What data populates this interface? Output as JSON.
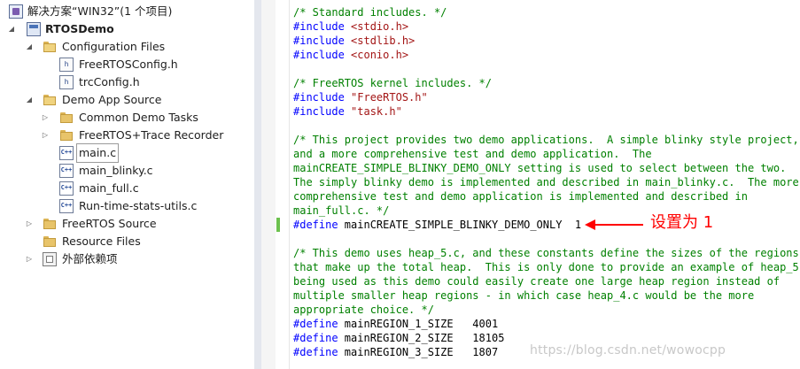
{
  "solution_explorer": {
    "solution_label": "解决方案“WIN32”(1 个项目)",
    "project": "RTOSDemo",
    "items": [
      {
        "label": "Configuration Files"
      },
      {
        "label": "FreeRTOSConfig.h"
      },
      {
        "label": "trcConfig.h"
      },
      {
        "label": "Demo App Source"
      },
      {
        "label": "Common Demo Tasks"
      },
      {
        "label": "FreeRTOS+Trace Recorder"
      },
      {
        "label": "main.c"
      },
      {
        "label": "main_blinky.c"
      },
      {
        "label": "main_full.c"
      },
      {
        "label": "Run-time-stats-utils.c"
      },
      {
        "label": "FreeRTOS Source"
      },
      {
        "label": "Resource Files"
      },
      {
        "label": "外部依赖项"
      }
    ],
    "icons": {
      "header_file": "h",
      "cpp_file": "C++"
    }
  },
  "code": {
    "l1": "/* Standard includes. */",
    "l2_kw": "#include",
    "l2_str": "<stdio.h>",
    "l3_kw": "#include",
    "l3_str": "<stdlib.h>",
    "l4_kw": "#include",
    "l4_str": "<conio.h>",
    "l6": "/* FreeRTOS kernel includes. */",
    "l7_kw": "#include",
    "l7_str": "\"FreeRTOS.h\"",
    "l8_kw": "#include",
    "l8_str": "\"task.h\"",
    "l10": "/* This project provides two demo applications.  A simple blinky style project,",
    "l11": "and a more comprehensive test and demo application.  The",
    "l12": "mainCREATE_SIMPLE_BLINKY_DEMO_ONLY setting is used to select between the two.",
    "l13": "The simply blinky demo is implemented and described in main_blinky.c.  The more",
    "l14": "comprehensive test and demo application is implemented and described in",
    "l15": "main_full.c. */",
    "l16_kw": "#define",
    "l16_rest": " mainCREATE_SIMPLE_BLINKY_DEMO_ONLY  1",
    "l18": "/* This demo uses heap_5.c, and these constants define the sizes of the regions",
    "l19": "that make up the total heap.  This is only done to provide an example of heap_5",
    "l20": "being used as this demo could easily create one large heap region instead of",
    "l21": "multiple smaller heap regions - in which case heap_4.c would be the more",
    "l22": "appropriate choice. */",
    "l23_kw": "#define",
    "l23_rest": " mainREGION_1_SIZE   4001",
    "l24_kw": "#define",
    "l24_rest": " mainREGION_2_SIZE   18105",
    "l25_kw": "#define",
    "l25_rest": " mainREGION_3_SIZE   1807"
  },
  "annotation": "设置为 1",
  "watermark": "https://blog.csdn.net/wowocpp",
  "colors": {
    "comment": "#008000",
    "keyword": "#0000ff",
    "string": "#a31515",
    "annotation": "#ff0000",
    "change_bar": "#6cc14e"
  }
}
